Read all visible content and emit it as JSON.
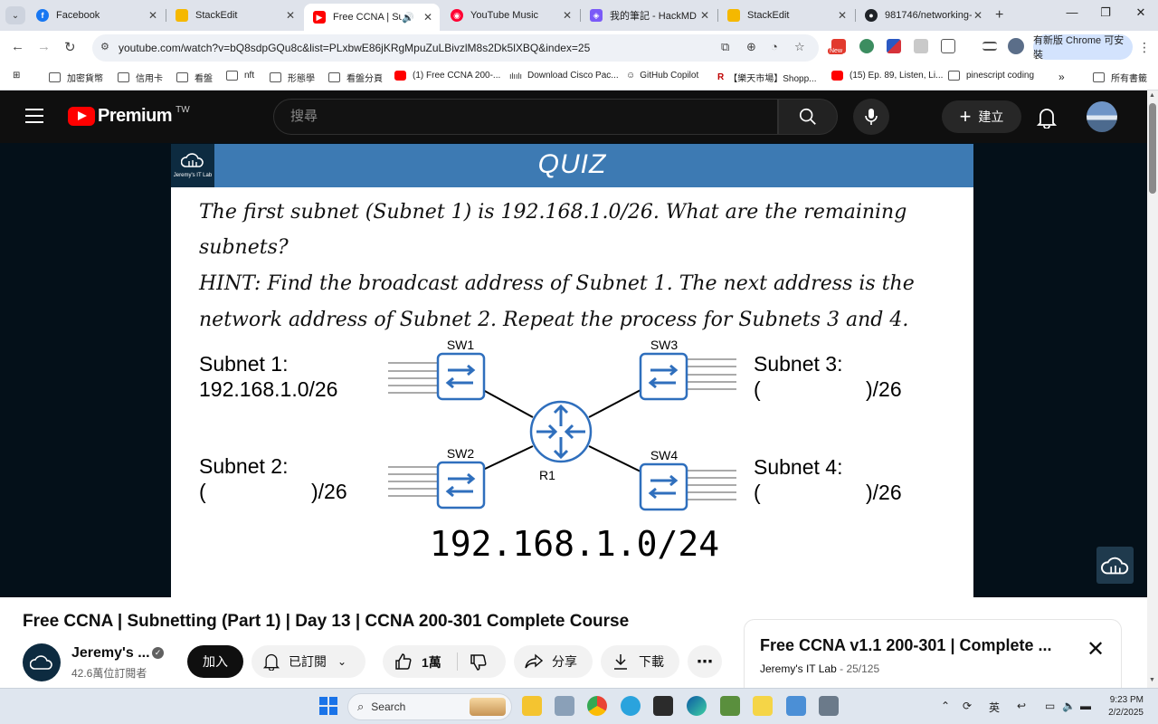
{
  "browser": {
    "tabs": [
      {
        "title": "Facebook",
        "color": "#1877f2",
        "glyph": "f"
      },
      {
        "title": "StackEdit",
        "color": "#f5b800",
        "glyph": ""
      },
      {
        "title": "Free CCNA | Subi",
        "color": "#ff0000",
        "glyph": "▶"
      },
      {
        "title": "YouTube Music",
        "color": "#ff0033",
        "glyph": "◉"
      },
      {
        "title": "我的筆記 - HackMD",
        "color": "#7a5af8",
        "glyph": "◈"
      },
      {
        "title": "StackEdit",
        "color": "#f5b800",
        "glyph": ""
      },
      {
        "title": "981746/networking-",
        "color": "#1f2328",
        "glyph": "●"
      }
    ],
    "url": "youtube.com/watch?v=bQ8sdpGQu8c&list=PLxbwE86jKRgMpuZuLBivzlM8s2Dk5lXBQ&index=25",
    "update_button": "有新版 Chrome 可安裝",
    "new_badge": "New"
  },
  "bookmarks": [
    {
      "label": "加密貨幣",
      "type": "folder"
    },
    {
      "label": "信用卡",
      "type": "folder"
    },
    {
      "label": "看盤",
      "type": "folder"
    },
    {
      "label": "nft",
      "type": "folder"
    },
    {
      "label": "形態學",
      "type": "folder"
    },
    {
      "label": "看盤分頁",
      "type": "folder"
    },
    {
      "label": "(1) Free CCNA 200-...",
      "type": "youtube"
    },
    {
      "label": "Download Cisco Pac...",
      "type": "link"
    },
    {
      "label": "GitHub Copilot",
      "type": "link"
    },
    {
      "label": "【樂天市場】Shopp...",
      "type": "rakuten"
    },
    {
      "label": "(15) Ep. 89, Listen, Li...",
      "type": "youtube"
    },
    {
      "label": "pinescript coding",
      "type": "folder"
    },
    {
      "label": "所有書籤",
      "type": "folder"
    }
  ],
  "youtube": {
    "logo_text": "Premium",
    "country": "TW",
    "search_placeholder": "搜尋",
    "create_label": "建立"
  },
  "slide": {
    "header": "QUIZ",
    "lab_badge": "Jeremy's IT Lab",
    "question_line1": "The first subnet (Subnet 1) is 192.168.1.0/26.  What are the remaining",
    "question_line2": "subnets?",
    "hint_line1": "HINT: Find the broadcast address of Subnet 1.  The next address is the",
    "hint_line2": "network address of Subnet 2.  Repeat the process for Subnets 3 and 4.",
    "switches": [
      "SW1",
      "SW2",
      "SW3",
      "SW4"
    ],
    "router": "R1",
    "subnet1_label": "Subnet 1:",
    "subnet1_value": "192.168.1.0/26",
    "subnet2_label": "Subnet 2:",
    "subnet3_label": "Subnet 3:",
    "subnet4_label": "Subnet 4:",
    "blank_open": "(",
    "blank_close": ")/26",
    "network": "192.168.1.0/24"
  },
  "video": {
    "title": "Free CCNA | Subnetting (Part 1) | Day 13 | CCNA 200-301 Complete Course",
    "channel": "Jeremy's ...",
    "subscribers": "42.6萬位訂閱者",
    "join": "加入",
    "subscribed": "已訂閱",
    "likes": "1萬",
    "share": "分享",
    "download": "下載"
  },
  "playlist": {
    "title": "Free CCNA v1.1 200-301 | Complete ...",
    "channel": "Jeremy's IT Lab",
    "position": "- 25/125"
  },
  "taskbar": {
    "search": "Search",
    "lang": "英",
    "time": "9:23 PM",
    "date": "2/2/2025"
  },
  "colors": {
    "slide_header": "#3d7ab3",
    "device_blue": "#2f6fbd",
    "youtube_red": "#ff0000"
  }
}
